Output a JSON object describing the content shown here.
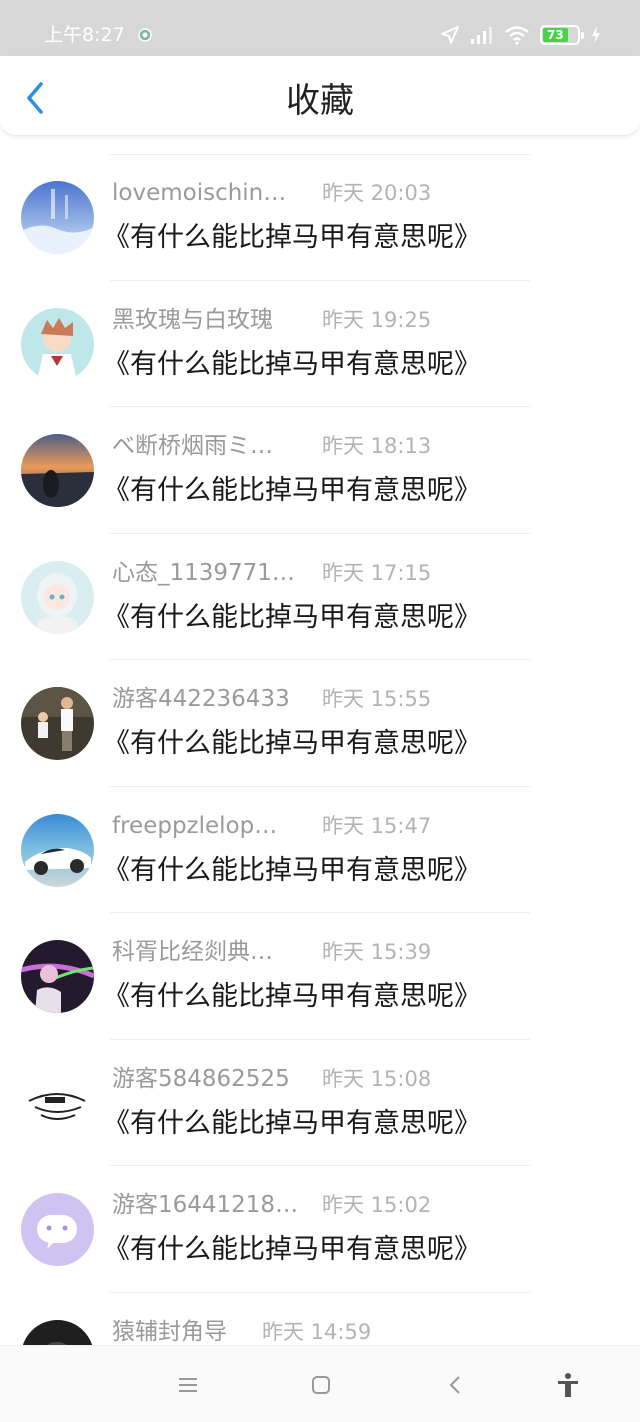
{
  "status_bar": {
    "time": "上午8:27",
    "battery_level": "73",
    "icons": [
      "notification-icon",
      "location-icon",
      "signal-icon",
      "wifi-icon",
      "battery-icon",
      "charging-icon"
    ]
  },
  "header": {
    "title": "收藏",
    "back_icon": "chevron-left-icon"
  },
  "items": [
    {
      "user": "lovemoischin…",
      "time": "昨天 20:03",
      "title": "《有什么能比掉马甲有意思呢》"
    },
    {
      "user": "黑玫瑰与白玫瑰",
      "time": "昨天 19:25",
      "title": "《有什么能比掉马甲有意思呢》"
    },
    {
      "user": "べ断桥烟雨ミ…",
      "time": "昨天 18:13",
      "title": "《有什么能比掉马甲有意思呢》"
    },
    {
      "user": "心态_1139771…",
      "time": "昨天 17:15",
      "title": "《有什么能比掉马甲有意思呢》"
    },
    {
      "user": "游客442236433",
      "time": "昨天 15:55",
      "title": "《有什么能比掉马甲有意思呢》"
    },
    {
      "user": "freeppzlelop…",
      "time": "昨天 15:47",
      "title": "《有什么能比掉马甲有意思呢》"
    },
    {
      "user": "科胥比经剡典…",
      "time": "昨天 15:39",
      "title": "《有什么能比掉马甲有意思呢》"
    },
    {
      "user": "游客584862525",
      "time": "昨天 15:08",
      "title": "《有什么能比掉马甲有意思呢》"
    },
    {
      "user": "游客16441218…",
      "time": "昨天 15:02",
      "title": "《有什么能比掉马甲有意思呢》"
    },
    {
      "user": "猿辅封角导",
      "time": "昨天 14:59",
      "title": ""
    }
  ],
  "nav_bar": {
    "icons": [
      "menu-icon",
      "home-icon",
      "back-icon",
      "accessibility-icon"
    ]
  },
  "colors": {
    "status_bar_bg": "#d7d7d7",
    "accent": "#2a8fe6",
    "battery": "#4cd14a",
    "username": "#9a9a9a",
    "time": "#b3b3b3",
    "title": "#1a1a1a"
  }
}
